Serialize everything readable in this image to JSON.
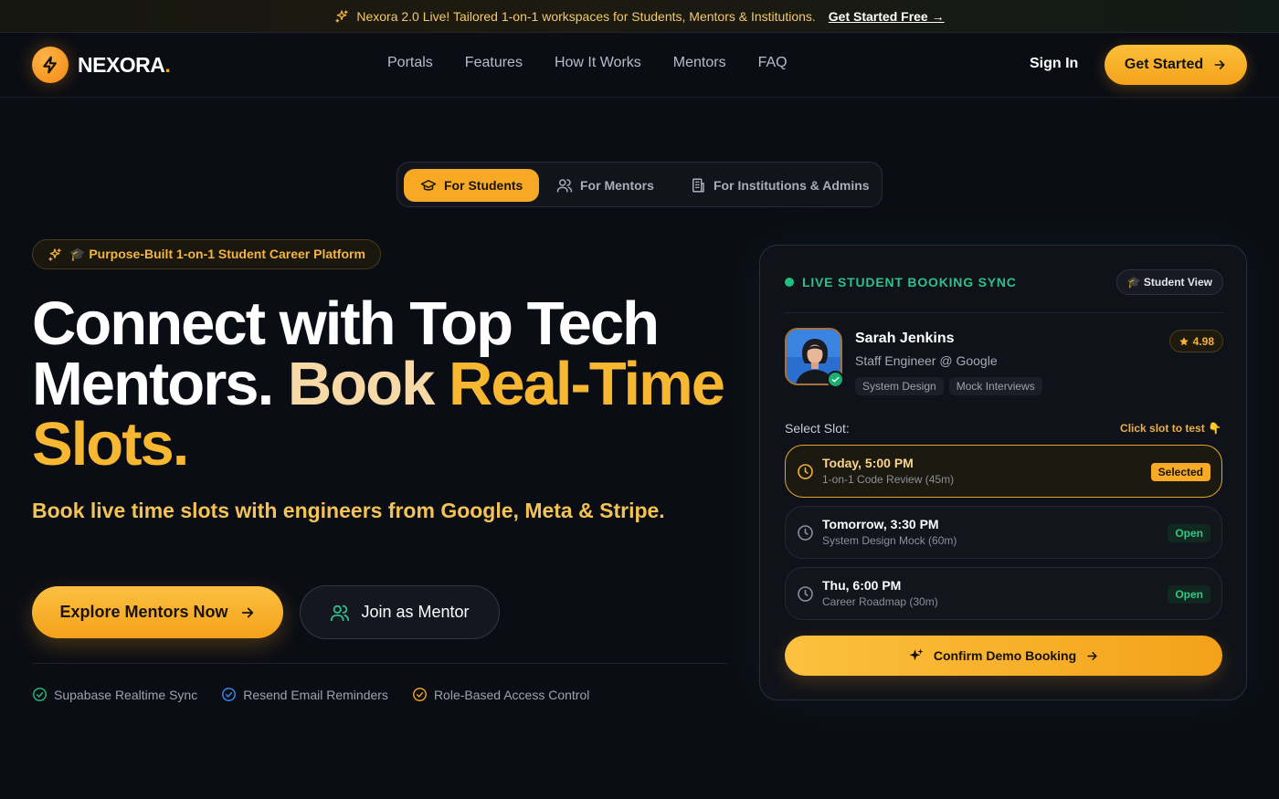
{
  "announcement": {
    "text": "Nexora 2.0 Live! Tailored 1-on-1 workspaces for Students, Mentors & Institutions.",
    "link": "Get Started Free →"
  },
  "nav": {
    "brand": "NEXORA",
    "brand_dot": ".",
    "links": [
      "Portals",
      "Features",
      "How It Works",
      "Mentors",
      "FAQ"
    ],
    "sign_in": "Sign In",
    "cta": "Get Started"
  },
  "portal_tabs": [
    {
      "label": "For Students",
      "icon": "graduation-cap-icon",
      "active": true
    },
    {
      "label": "For Mentors",
      "icon": "users-icon",
      "active": false
    },
    {
      "label": "For Institutions & Admins",
      "icon": "building-icon",
      "active": false
    }
  ],
  "hero": {
    "badge": "🎓 Purpose-Built 1-on-1 Student Career Platform",
    "headline_line1": "Connect with Top Tech",
    "headline_line2_white": "Mentors.",
    "headline_line2_light": "Book",
    "headline_line2_gold": "Real-Time",
    "headline_line3": "Slots.",
    "subhead": "Book live time slots with engineers from Google, Meta & Stripe.",
    "primary_cta": "Explore Mentors Now",
    "secondary_cta": "Join as Mentor",
    "features": [
      "Supabase Realtime Sync",
      "Resend Email Reminders",
      "Role-Based Access Control"
    ]
  },
  "booking_card": {
    "live_label": "LIVE STUDENT BOOKING SYNC",
    "view_pill": "🎓 Student View",
    "mentor": {
      "name": "Sarah Jenkins",
      "role": "Staff Engineer @ Google",
      "rating": "4.98",
      "tags": [
        "System Design",
        "Mock Interviews"
      ]
    },
    "select_label": "Select Slot:",
    "hint": "Click slot to test 👇",
    "slots": [
      {
        "time": "Today, 5:00 PM",
        "detail": "1-on-1 Code Review (45m)",
        "status": "Selected"
      },
      {
        "time": "Tomorrow, 3:30 PM",
        "detail": "System Design Mock (60m)",
        "status": "Open"
      },
      {
        "time": "Thu, 6:00 PM",
        "detail": "Career Roadmap (30m)",
        "status": "Open"
      }
    ],
    "confirm": "Confirm Demo Booking"
  },
  "colors": {
    "accent": "#f5a623",
    "background": "#0b0d14",
    "live_green": "#22c07e"
  }
}
